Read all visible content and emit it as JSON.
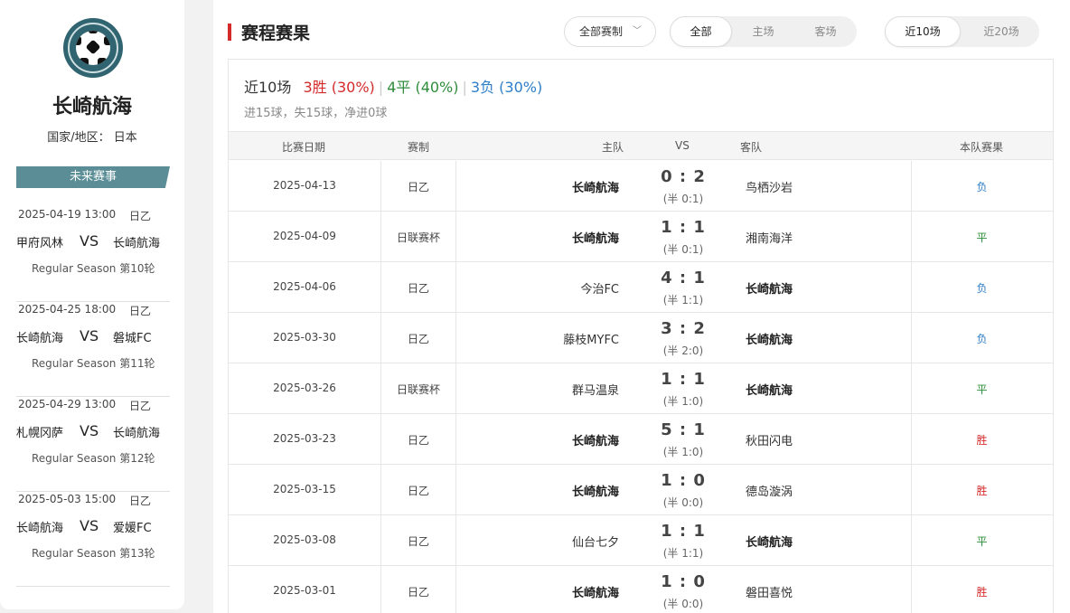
{
  "team": {
    "name": "长崎航海",
    "country_label": "国家/地区：",
    "country": "日本"
  },
  "future": {
    "header": "未来赛事",
    "matches": [
      {
        "datetime": "2025-04-19 13:00",
        "league": "日乙",
        "home": "甲府风林",
        "vs": "VS",
        "away": "长崎航海",
        "round": "Regular Season  第10轮"
      },
      {
        "datetime": "2025-04-25 18:00",
        "league": "日乙",
        "home": "长崎航海",
        "vs": "VS",
        "away": "磐城FC",
        "round": "Regular Season  第11轮"
      },
      {
        "datetime": "2025-04-29 13:00",
        "league": "日乙",
        "home": "札幌冈萨",
        "vs": "VS",
        "away": "长崎航海",
        "round": "Regular Season  第12轮"
      },
      {
        "datetime": "2025-05-03 15:00",
        "league": "日乙",
        "home": "长崎航海",
        "vs": "VS",
        "away": "爱媛FC",
        "round": "Regular Season  第13轮"
      }
    ]
  },
  "main": {
    "title": "赛程赛果",
    "filter_dropdown": "全部赛制",
    "venue_tabs": [
      "全部",
      "主场",
      "客场"
    ],
    "range_tabs": [
      "近10场",
      "近20场"
    ],
    "summary": {
      "label": "近10场",
      "wins": "3胜 (30%)",
      "draws": "4平 (40%)",
      "losses": "3负 (30%)",
      "goals": "进15球，失15球，净进0球"
    },
    "columns": {
      "date": "比赛日期",
      "competition": "赛制",
      "home": "主队",
      "vs": "VS",
      "away": "客队",
      "result": "本队赛果"
    },
    "rows": [
      {
        "date": "2025-04-13",
        "comp": "日乙",
        "home": "长崎航海",
        "score": "0 : 2",
        "half": "(半 0:1)",
        "away": "鸟栖沙岩",
        "result": "负",
        "team_home": true,
        "type": "loss"
      },
      {
        "date": "2025-04-09",
        "comp": "日联赛杯",
        "home": "长崎航海",
        "score": "1 : 1",
        "half": "(半 0:1)",
        "away": "湘南海洋",
        "result": "平",
        "team_home": true,
        "type": "draw"
      },
      {
        "date": "2025-04-06",
        "comp": "日乙",
        "home": "今治FC",
        "score": "4 : 1",
        "half": "(半 1:1)",
        "away": "长崎航海",
        "result": "负",
        "team_home": false,
        "type": "loss"
      },
      {
        "date": "2025-03-30",
        "comp": "日乙",
        "home": "藤枝MYFC",
        "score": "3 : 2",
        "half": "(半 2:0)",
        "away": "长崎航海",
        "result": "负",
        "team_home": false,
        "type": "loss"
      },
      {
        "date": "2025-03-26",
        "comp": "日联赛杯",
        "home": "群马温泉",
        "score": "1 : 1",
        "half": "(半 1:0)",
        "away": "长崎航海",
        "result": "平",
        "team_home": false,
        "type": "draw"
      },
      {
        "date": "2025-03-23",
        "comp": "日乙",
        "home": "长崎航海",
        "score": "5 : 1",
        "half": "(半 1:0)",
        "away": "秋田闪电",
        "result": "胜",
        "team_home": true,
        "type": "win"
      },
      {
        "date": "2025-03-15",
        "comp": "日乙",
        "home": "长崎航海",
        "score": "1 : 0",
        "half": "(半 0:0)",
        "away": "德岛漩涡",
        "result": "胜",
        "team_home": true,
        "type": "win"
      },
      {
        "date": "2025-03-08",
        "comp": "日乙",
        "home": "仙台七夕",
        "score": "1 : 1",
        "half": "(半 1:1)",
        "away": "长崎航海",
        "result": "平",
        "team_home": false,
        "type": "draw"
      },
      {
        "date": "2025-03-01",
        "comp": "日乙",
        "home": "长崎航海",
        "score": "1 : 0",
        "half": "(半 0:0)",
        "away": "磐田喜悦",
        "result": "胜",
        "team_home": true,
        "type": "win"
      }
    ]
  },
  "colors": {
    "accent_red": "#d42a2a",
    "win": "#d42a2a",
    "draw": "#2e8b3a",
    "loss": "#2f7ec8",
    "teal": "#5a8d96"
  }
}
